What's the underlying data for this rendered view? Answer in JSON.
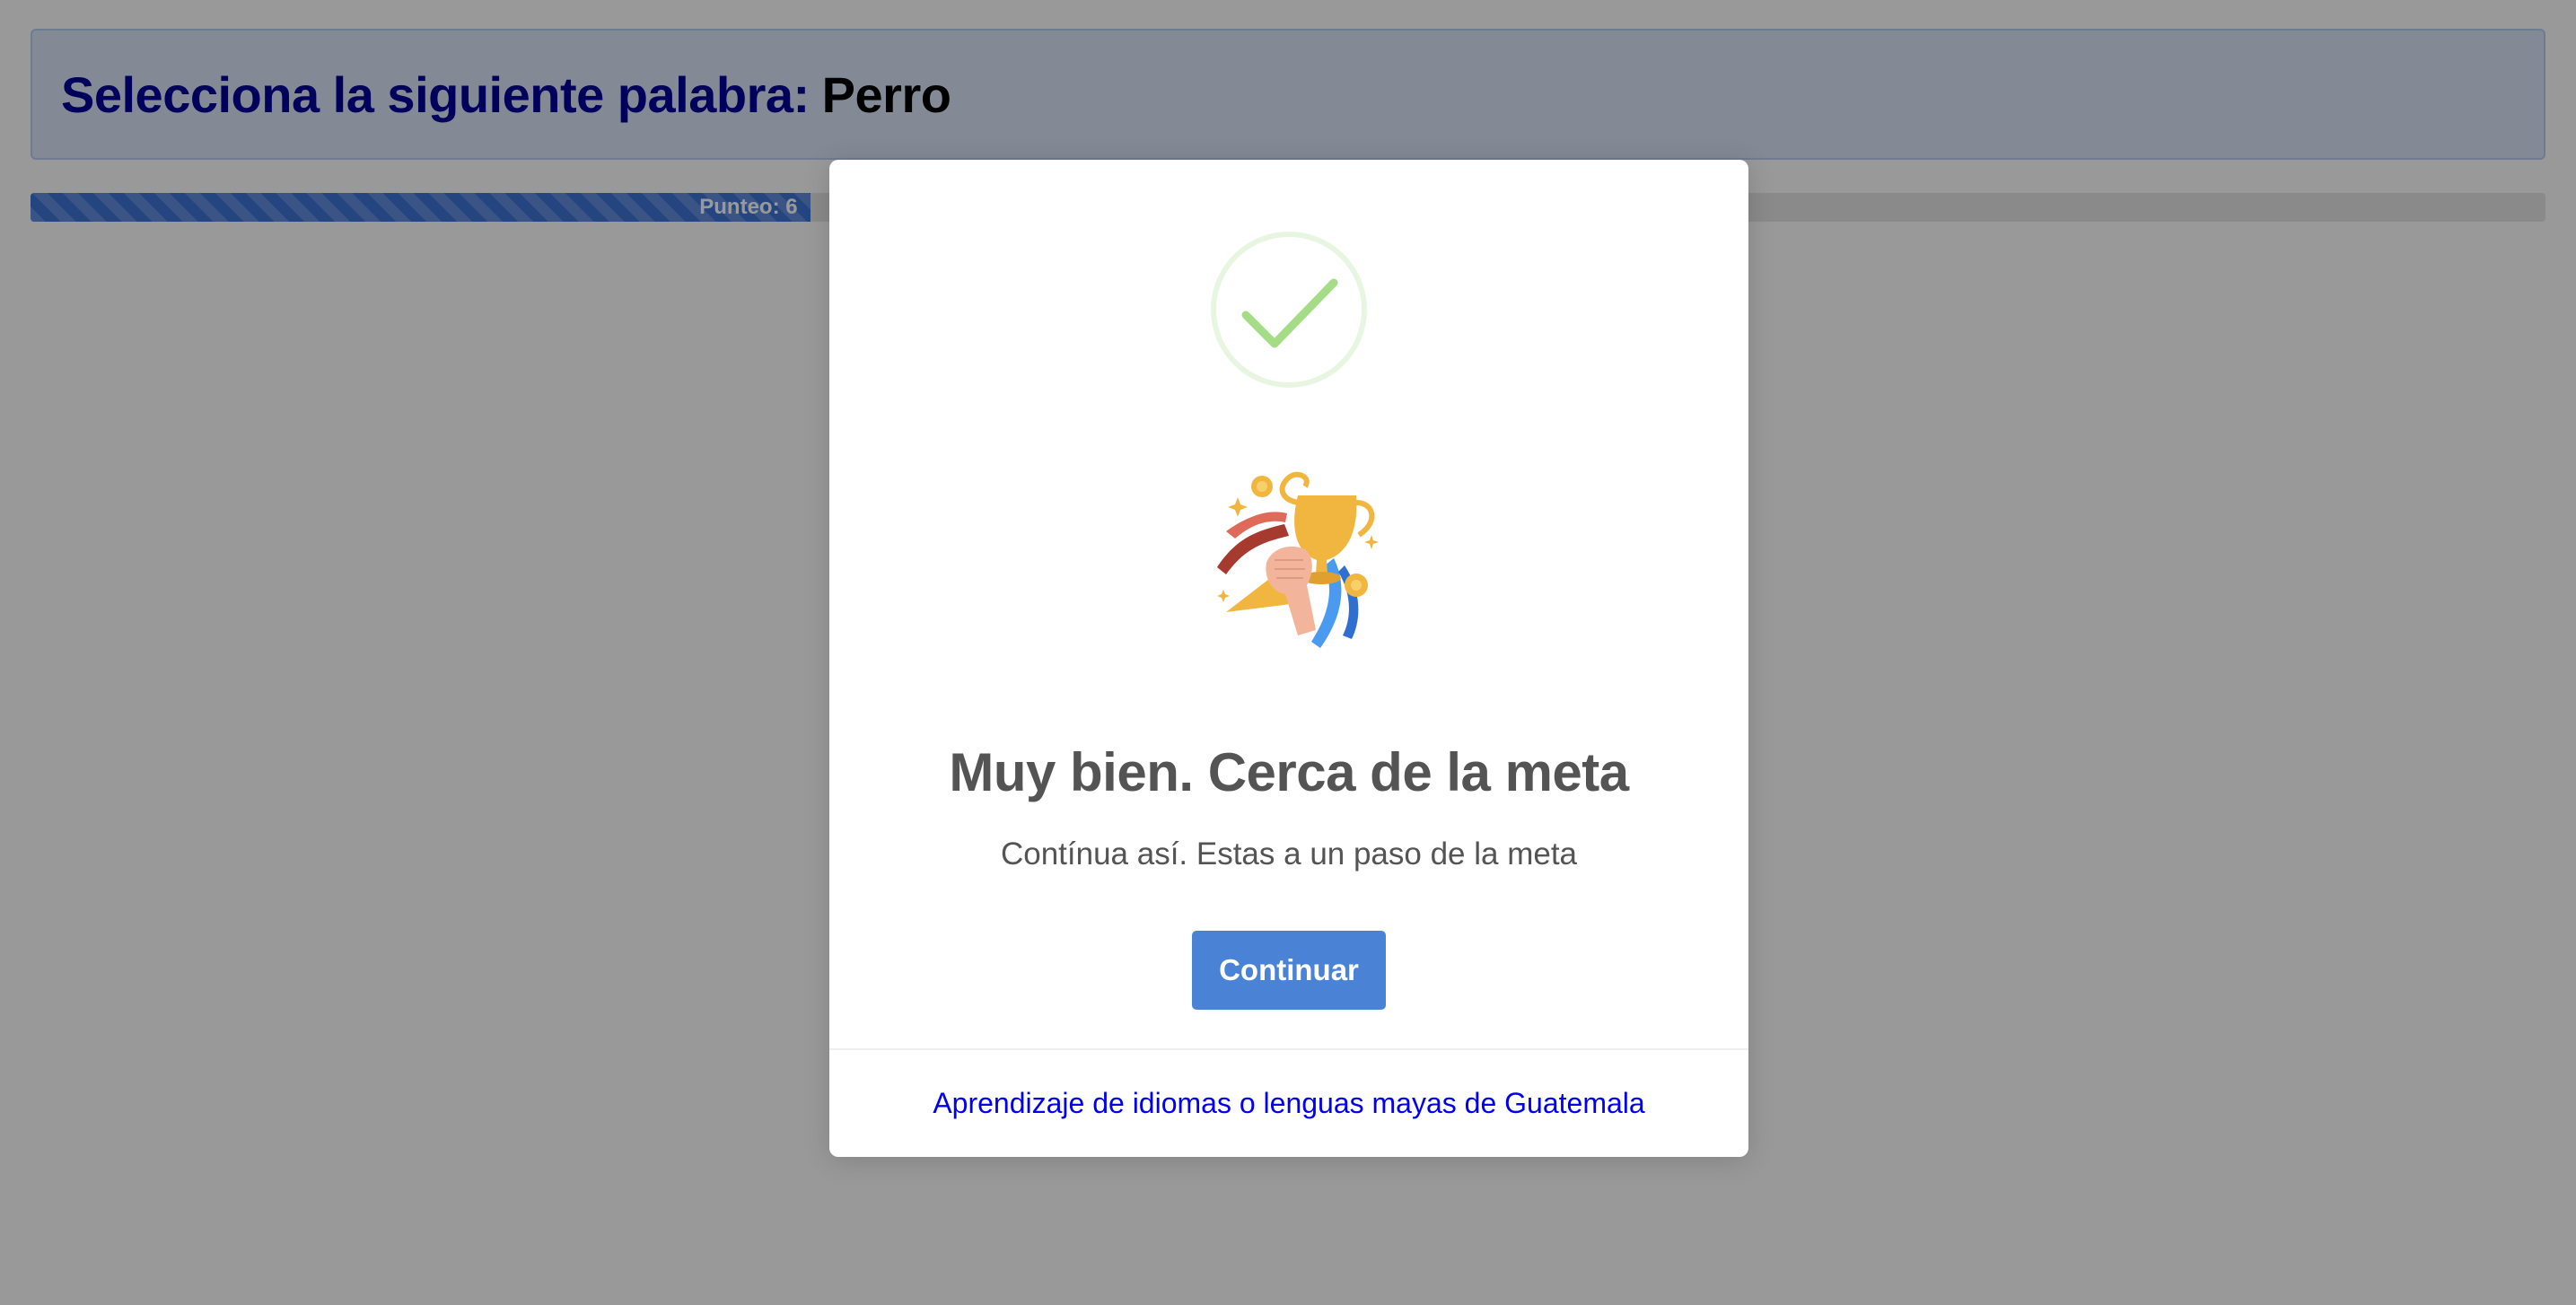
{
  "question": {
    "prompt": "Selecciona la siguiente palabra:",
    "word": "Perro"
  },
  "progress": {
    "label": "Punteo: 6",
    "fraction_visible": 0.31,
    "color": "#3f73d8"
  },
  "modal": {
    "icon": "success-check-icon",
    "illustration": "trophy-celebration-icon",
    "title": "Muy bien. Cerca de la meta",
    "text": "Contínua así. Estas a un paso de la meta",
    "confirm_label": "Continuar",
    "footer_link": "Aprendizaje de idiomas o lenguas mayas de Guatemala"
  },
  "colors": {
    "prompt": "#00009a",
    "button": "#4a83d6",
    "link": "#0000ee",
    "success": "#a5dc86"
  }
}
